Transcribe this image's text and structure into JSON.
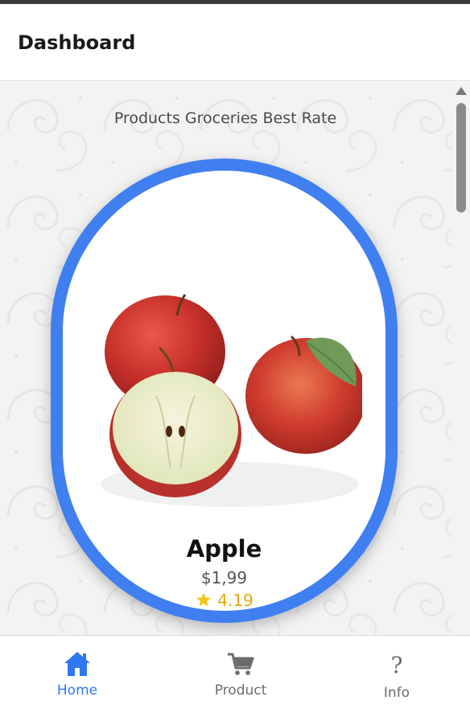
{
  "header": {
    "title": "Dashboard"
  },
  "main": {
    "subtitle": "Products Groceries Best Rate"
  },
  "product_card": {
    "name": "Apple",
    "price": "$1,99",
    "rating": "4.19",
    "image_icon": "apple-photo",
    "rating_icon": "star-icon"
  },
  "bottom_nav": {
    "items": [
      {
        "label": "Home",
        "icon": "home-icon",
        "active": true
      },
      {
        "label": "Product",
        "icon": "cart-icon",
        "active": false
      },
      {
        "label": "Info",
        "icon": "question-icon",
        "active": false
      }
    ]
  },
  "colors": {
    "accent": "#3f7ff0",
    "active_nav": "#2f78ef",
    "rating": "#e3a90a"
  }
}
